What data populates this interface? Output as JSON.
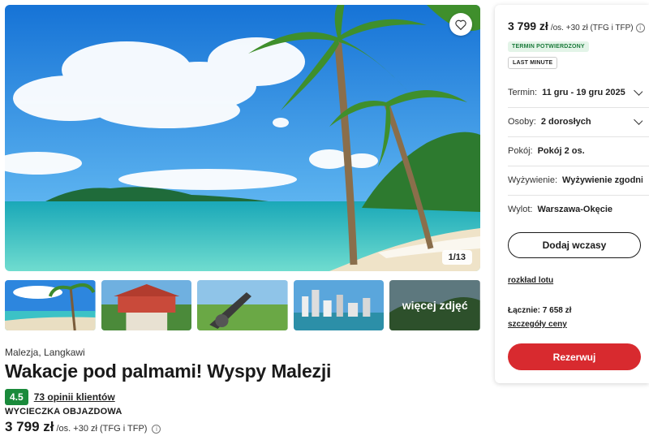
{
  "gallery": {
    "counter": "1/13",
    "more_photos": "więcej zdjęć"
  },
  "offer": {
    "location": "Malezja, Langkawi",
    "title": "Wakacje pod palmami! Wyspy Malezji",
    "rating": "4.5",
    "reviews": "73 opinii klientów",
    "trip_type": "WYCIECZKA OBJAZDOWA",
    "price": "3 799 zł",
    "price_suffix": "/os. +30 zł (TFG i TFP)"
  },
  "sidebar": {
    "price": "3 799 zł",
    "price_suffix": "/os. +30 zł (TFG i TFP)",
    "badge_confirmed": "TERMIN POTWIERDZONY",
    "badge_last_minute": "LAST MINUTE",
    "term_label": "Termin:",
    "term_value": "11 gru - 19 gru 2025",
    "persons_label": "Osoby:",
    "persons_value": "2 dorosłych",
    "room_label": "Pokój:",
    "room_value": "Pokój 2 os.",
    "board_label": "Wyżywienie:",
    "board_value": "Wyżywienie zgodni…",
    "departure_label": "Wylot:",
    "departure_value": "Warszawa-Okęcie",
    "add_button": "Dodaj wczasy",
    "flight_schedule": "rozkład lotu",
    "total": "Łącznie: 7 658 zł",
    "price_details": "szczegóły ceny",
    "reserve_button": "Rezerwuj"
  },
  "colors": {
    "accent_red": "#d82a2f",
    "rating_green": "#1a8a3b",
    "badge_green": "#1a7a3a"
  },
  "icons": [
    "heart-icon",
    "chevron-down-icon",
    "info-icon"
  ]
}
